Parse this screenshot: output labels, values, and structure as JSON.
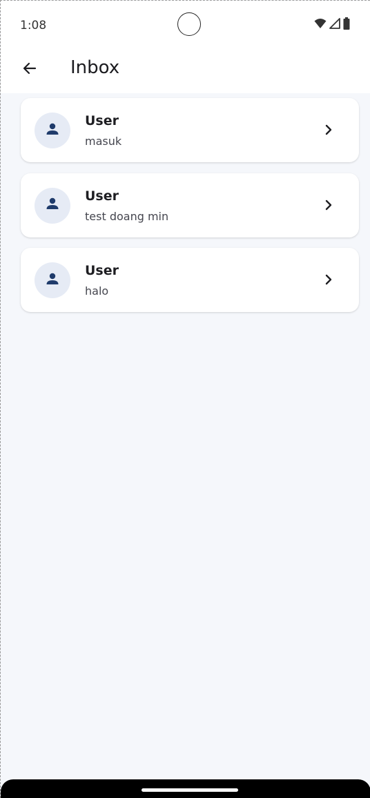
{
  "status_bar": {
    "time": "1:08",
    "icons": [
      "wifi-icon",
      "signal-icon",
      "battery-icon"
    ]
  },
  "app_bar": {
    "back_icon": "arrow-left-icon",
    "title": "Inbox"
  },
  "inbox": {
    "items": [
      {
        "name": "User",
        "message": "masuk"
      },
      {
        "name": "User",
        "message": "test doang min"
      },
      {
        "name": "User",
        "message": "halo"
      }
    ]
  },
  "colors": {
    "background": "#f5f7fb",
    "surface": "#ffffff",
    "avatar_bg": "#e6ebf5",
    "avatar_icon": "#1f3b6b",
    "text_primary": "#1e1e22",
    "text_secondary": "#45464f"
  }
}
